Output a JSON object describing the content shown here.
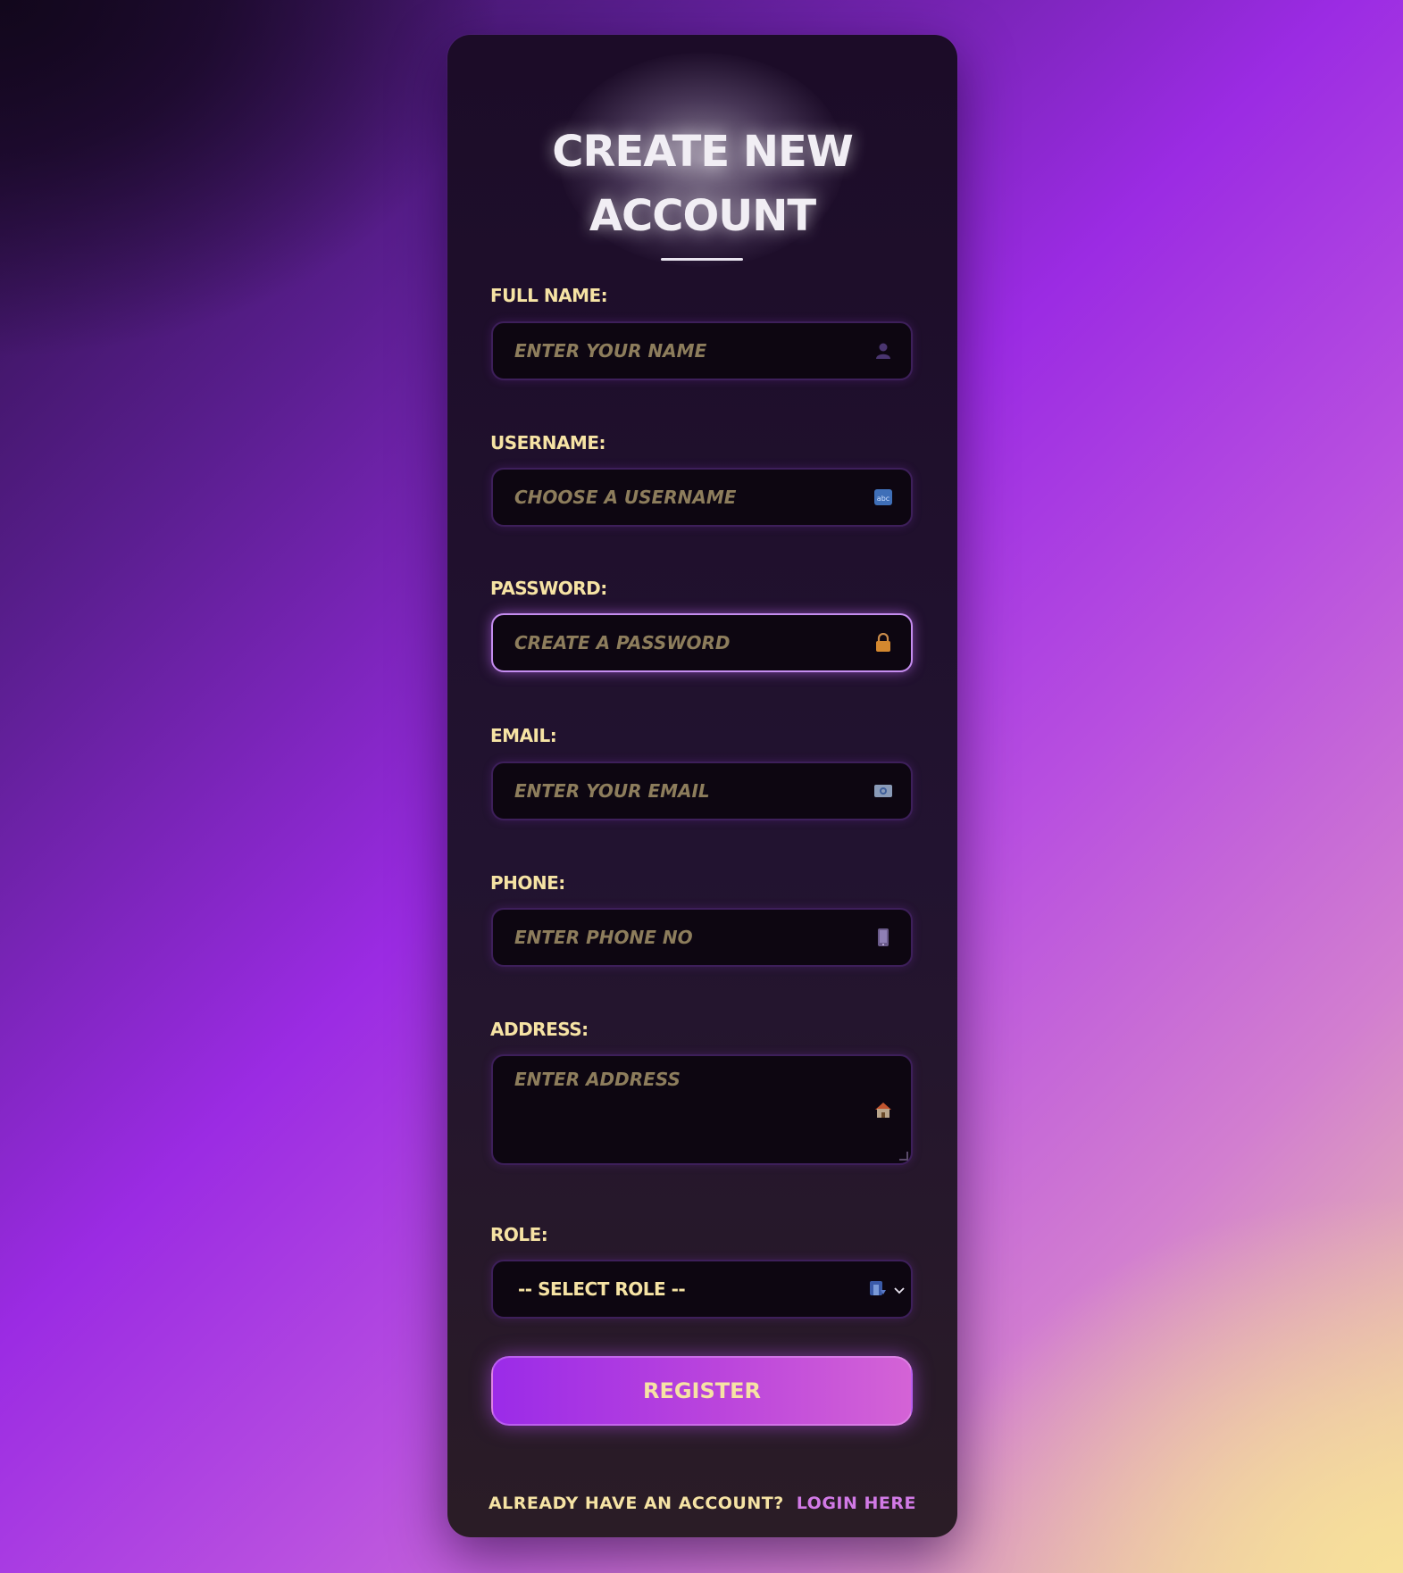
{
  "form": {
    "title_line1": "Create New",
    "title_line2": "Account",
    "fields": {
      "full_name": {
        "label": "Full Name:",
        "placeholder": "Enter your name",
        "value": "",
        "icon": "person-silhouette-icon"
      },
      "username": {
        "label": "Username:",
        "placeholder": "Choose a username",
        "value": "",
        "icon": "abc-icon"
      },
      "password": {
        "label": "Password:",
        "placeholder": "Create a password",
        "value": "",
        "icon": "lock-icon"
      },
      "email": {
        "label": "Email:",
        "placeholder": "Enter your email",
        "value": "",
        "icon": "email-icon"
      },
      "phone": {
        "label": "Phone:",
        "placeholder": "Enter phone no",
        "value": "",
        "icon": "phone-icon"
      },
      "address": {
        "label": "Address:",
        "placeholder": "Enter address",
        "value": "",
        "icon": "house-icon"
      },
      "role": {
        "label": "Role:",
        "selected": "-- Select Role --",
        "icon": "role-person-icon"
      }
    },
    "register_label": "Register",
    "footer_text": "Already have an account?",
    "login_link": "Login here"
  },
  "colors": {
    "label": "#f6e3a4",
    "placeholder": "#8d7d5c",
    "accent": "#9b2be8",
    "link": "#d27ae6",
    "card_bg": "#1c0c28",
    "field_bg": "#0d0611"
  }
}
